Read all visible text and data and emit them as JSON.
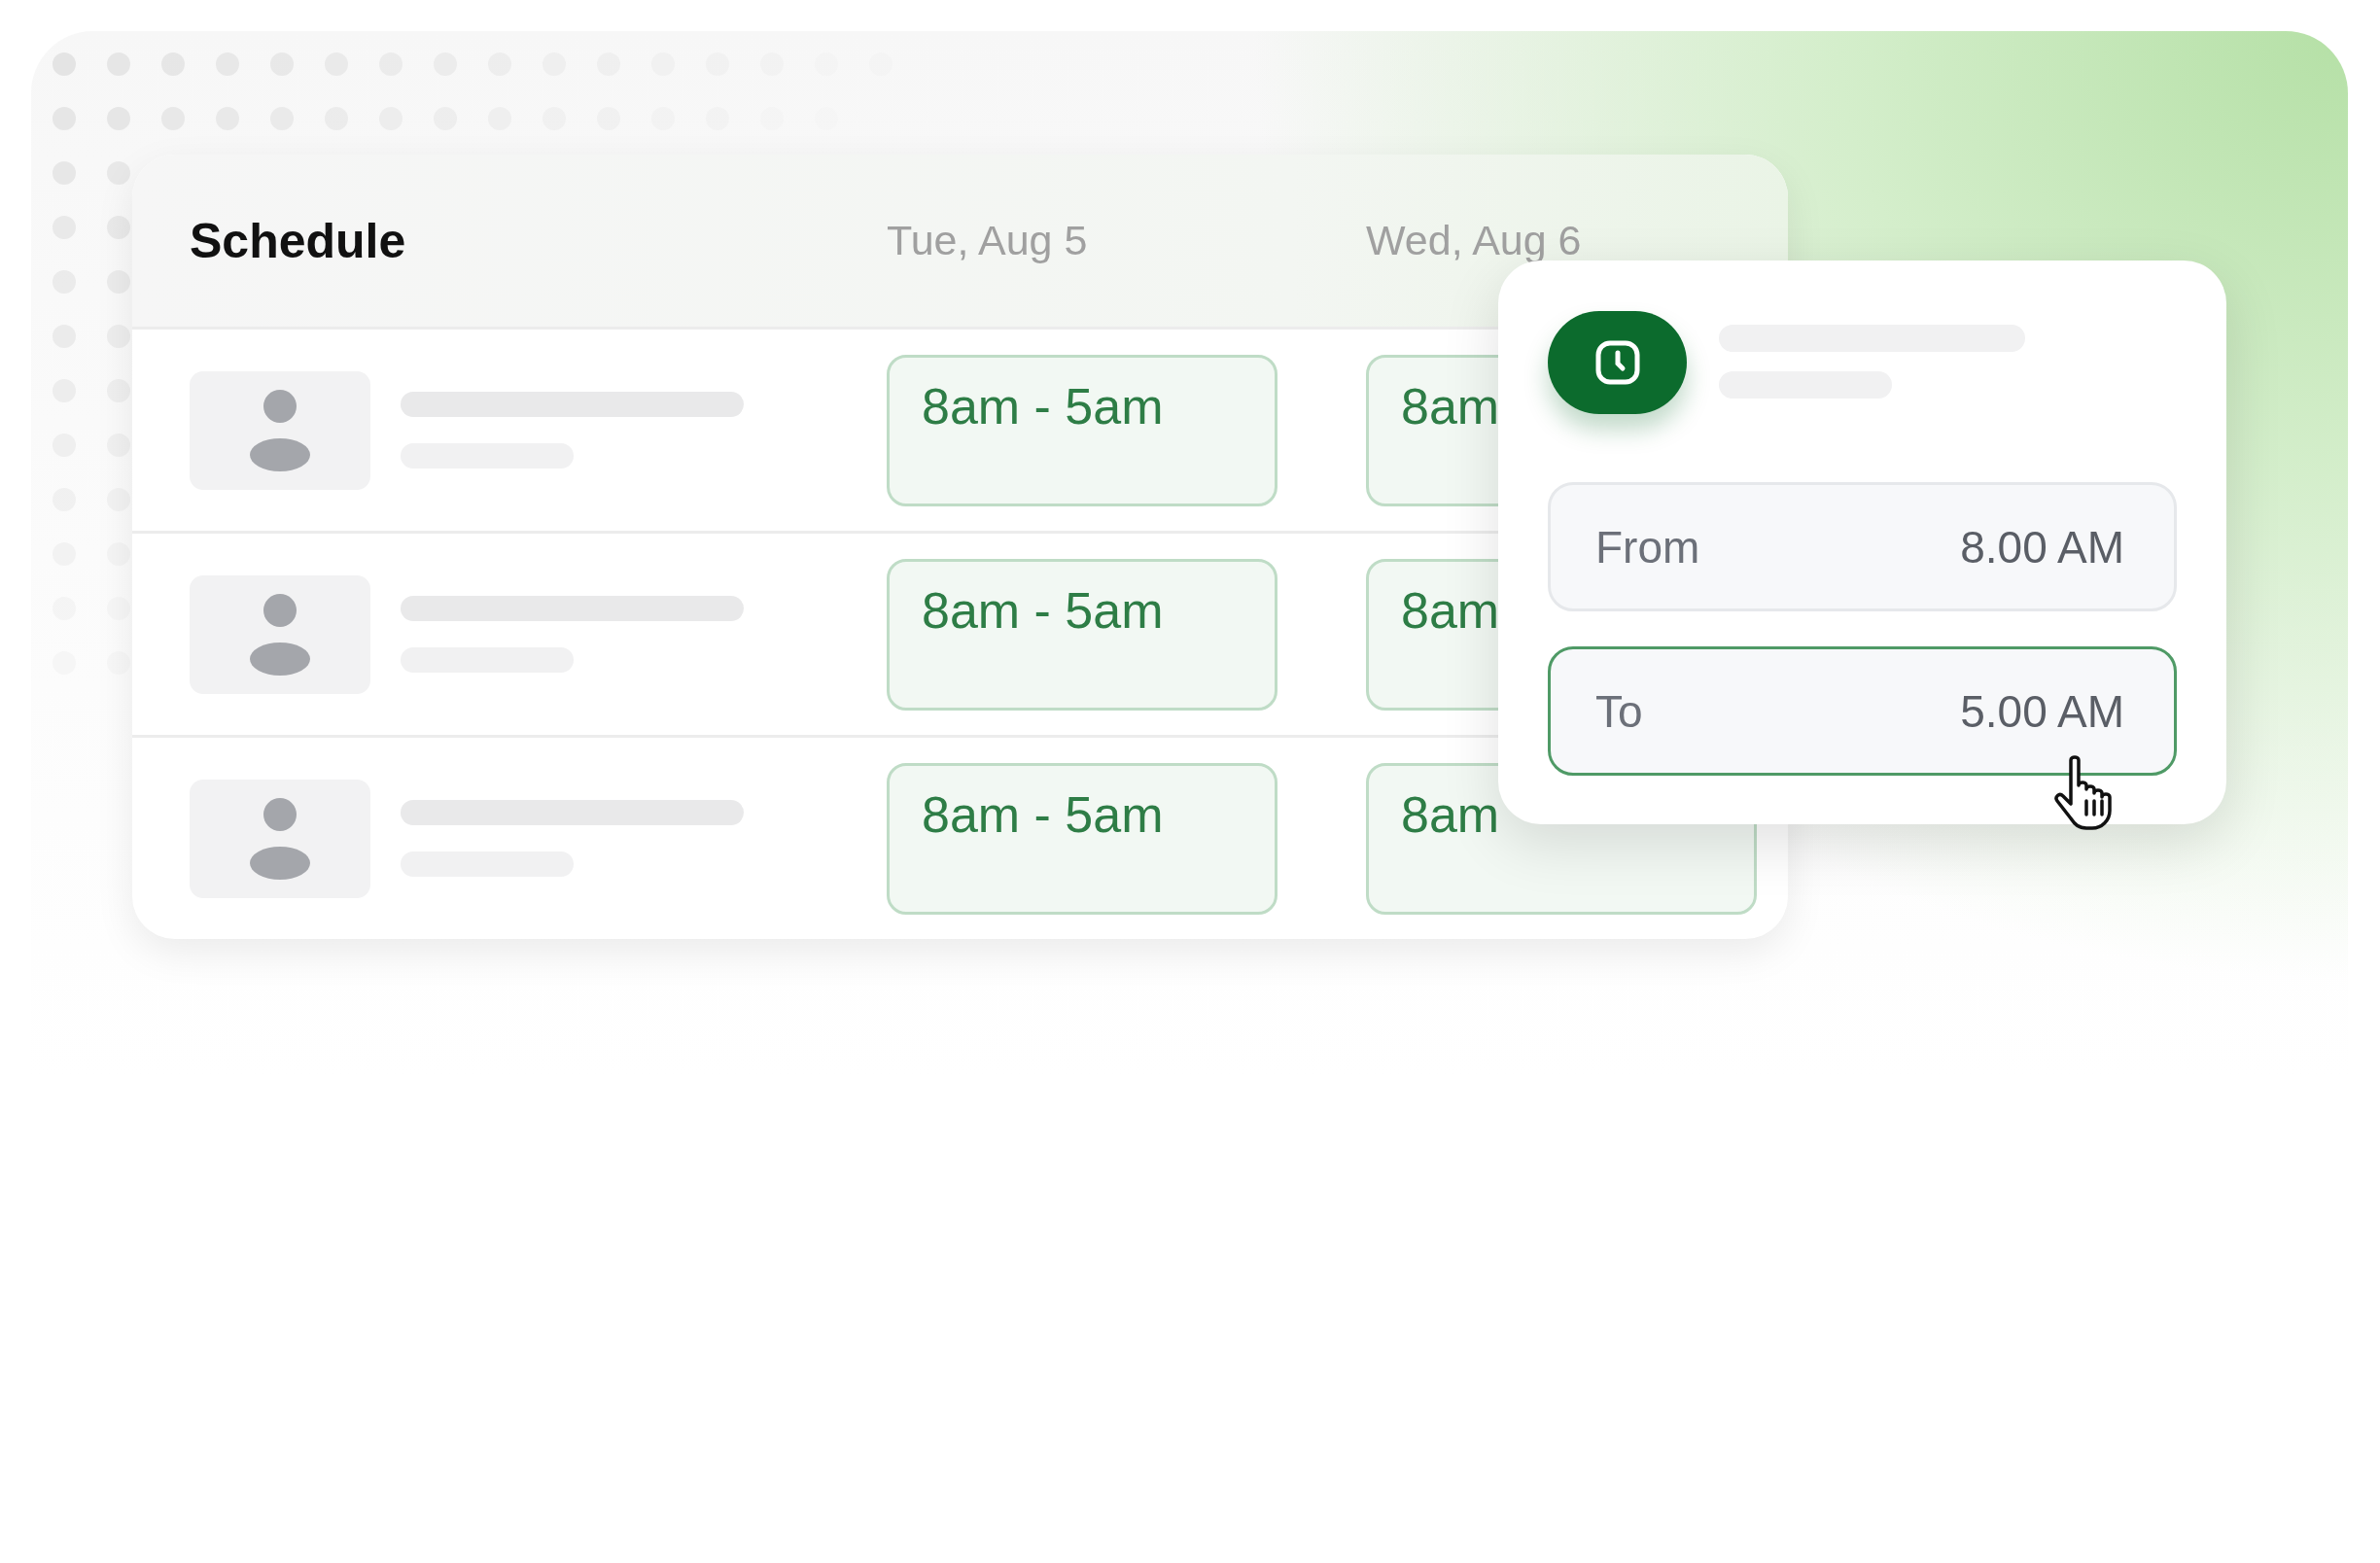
{
  "schedule": {
    "title": "Schedule",
    "columns": [
      "Tue, Aug 5",
      "Wed, Aug 6"
    ],
    "rows": [
      {
        "shifts": [
          "8am - 5am",
          "8am"
        ]
      },
      {
        "shifts": [
          "8am - 5am",
          "8am"
        ]
      },
      {
        "shifts": [
          "8am - 5am",
          "8am"
        ]
      }
    ]
  },
  "time_popup": {
    "fields": [
      {
        "label": "From",
        "value": "8.00 AM",
        "selected": false
      },
      {
        "label": "To",
        "value": "5.00 AM",
        "selected": true
      }
    ]
  }
}
